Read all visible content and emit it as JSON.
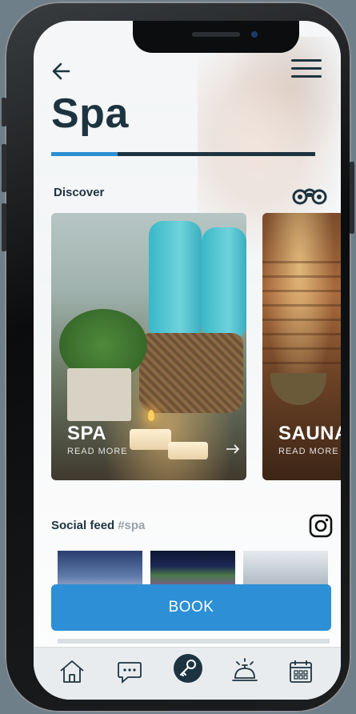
{
  "header": {
    "title": "Spa",
    "progress": 0.25,
    "back_icon": "back-arrow-icon",
    "menu_icon": "hamburger-menu-icon"
  },
  "discover": {
    "label": "Discover",
    "icon": "binoculars-icon",
    "cards": [
      {
        "title": "SPA",
        "subtitle": "READ MORE"
      },
      {
        "title": "SAUNA",
        "subtitle": "READ MORE"
      }
    ]
  },
  "social": {
    "label": "Social feed",
    "hashtag": "#spa",
    "icon": "instagram-icon"
  },
  "book_label": "BOOK",
  "tabbar": {
    "items": [
      "home-icon",
      "chat-icon",
      "key-icon",
      "concierge-bell-icon",
      "calendar-icon"
    ]
  },
  "colors": {
    "accent": "#2d8fd5",
    "dark": "#1d3440"
  }
}
